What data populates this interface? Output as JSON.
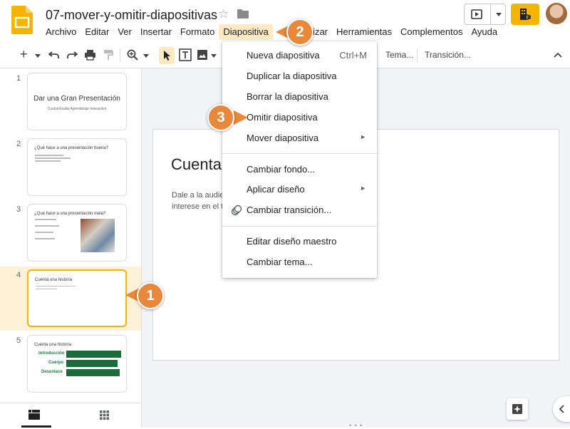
{
  "header": {
    "doc_title": "07-mover-y-omitir-diapositivas",
    "menu": [
      "Archivo",
      "Editar",
      "Ver",
      "Insertar",
      "Formato",
      "Diapositiva",
      "Organizar",
      "Herramientas",
      "Complementos",
      "Ayuda"
    ],
    "active_menu": "Diapositiva"
  },
  "toolbar": {
    "tema_label": "Tema...",
    "transicion_label": "Transición..."
  },
  "filmstrip": {
    "slides": [
      {
        "number": "1",
        "title": "Dar una Gran Presentación",
        "subtitle": "CustomGuide Aprendizaje Interactivo"
      },
      {
        "number": "2",
        "title": "¿Qué hace a una presentación buena?"
      },
      {
        "number": "3",
        "title": "¿Qué hace a una presentación mala?"
      },
      {
        "number": "4",
        "title": "Cuenta una historia"
      },
      {
        "number": "5",
        "title": "Cuenta una historia",
        "labels": [
          "Introducción",
          "Cuerpo",
          "Desenlace"
        ]
      }
    ]
  },
  "slide": {
    "title": "Cuenta",
    "body_line1": "Dale a la audie",
    "body_line2": "interese en el t"
  },
  "dropdown": {
    "items": [
      {
        "label": "Nueva diapositiva",
        "shortcut": "Ctrl+M"
      },
      {
        "label": "Duplicar la diapositiva"
      },
      {
        "label": "Borrar la diapositiva"
      },
      {
        "label": "Omitir diapositiva"
      },
      {
        "label": "Mover diapositiva",
        "submenu": "►"
      },
      {
        "label": "Cambiar fondo..."
      },
      {
        "label": "Aplicar diseño",
        "submenu": "►"
      },
      {
        "label": "Cambiar transición..."
      },
      {
        "label": "Editar diseño maestro"
      },
      {
        "label": "Cambiar tema..."
      }
    ]
  },
  "callouts": [
    "1",
    "2",
    "3"
  ],
  "colors": {
    "accent": "#f4b400",
    "callout": "#e8883a",
    "active_menu_bg": "#fbe9c4",
    "thumb_green": "#1e6b3a"
  }
}
